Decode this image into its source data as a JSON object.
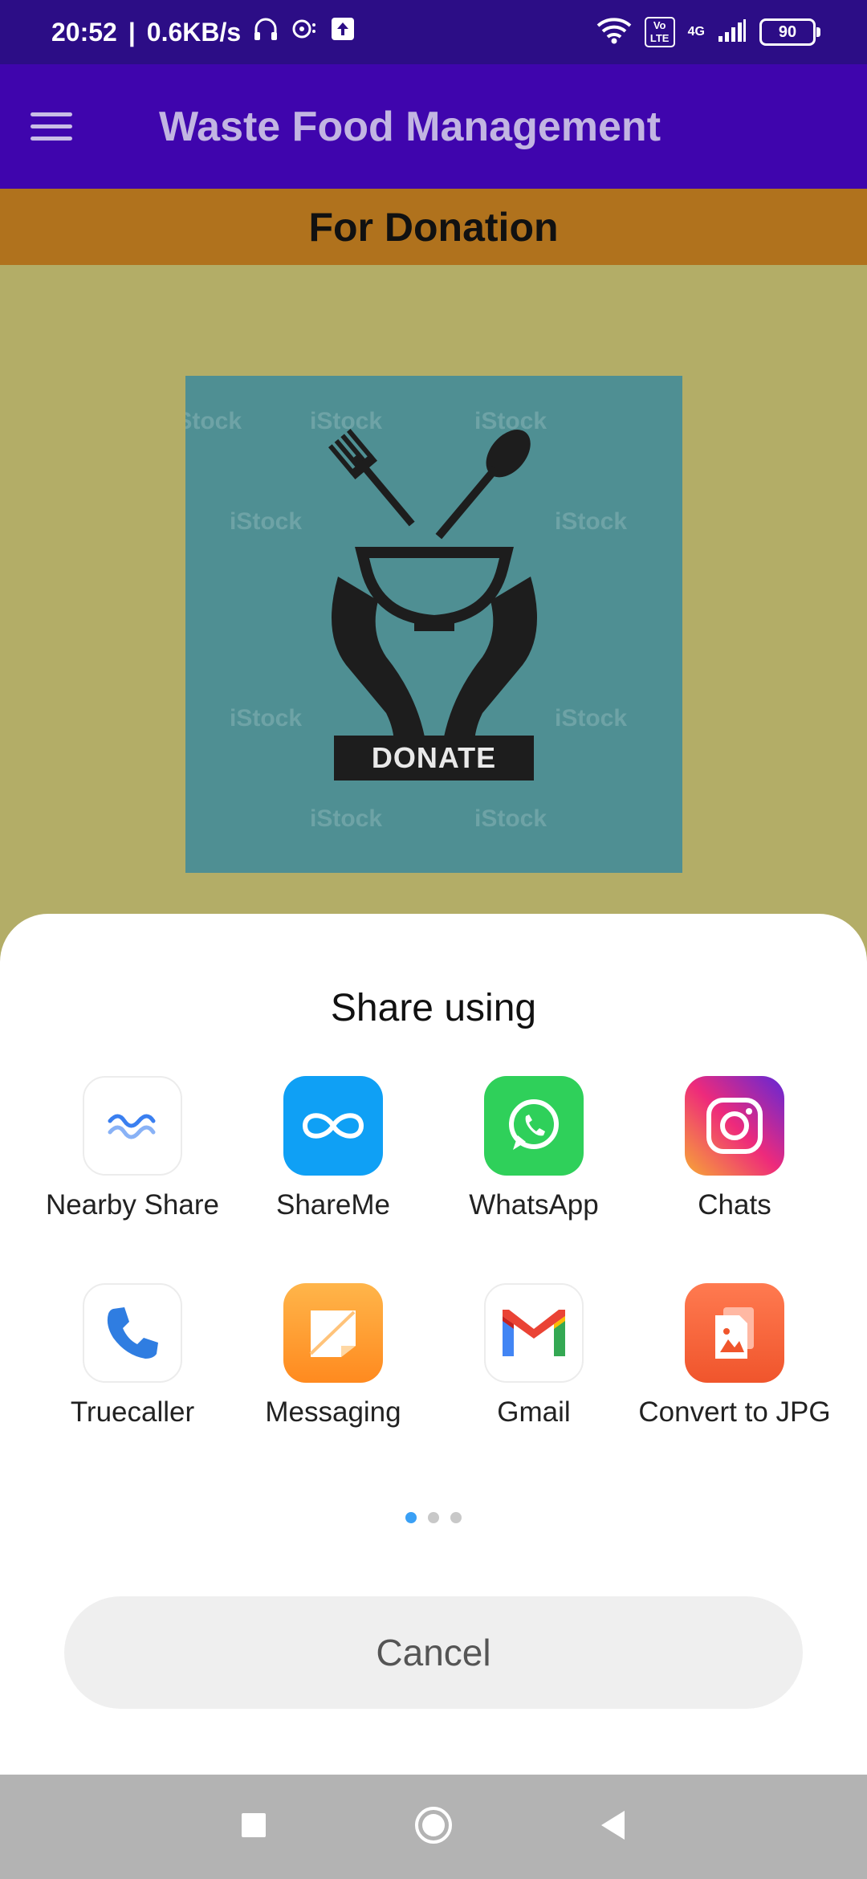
{
  "status_bar": {
    "time": "20:52",
    "speed": "0.6KB/s",
    "volte": "Vo LTE",
    "network": "4G",
    "battery": "90"
  },
  "app_bar": {
    "title": "Waste Food Management"
  },
  "banner": {
    "text": "For Donation"
  },
  "image": {
    "badge_text": "DONATE",
    "watermark": "iStock"
  },
  "share_sheet": {
    "title": "Share using",
    "apps": [
      {
        "label": "Nearby Share",
        "icon": "nearby-share-icon"
      },
      {
        "label": "ShareMe",
        "icon": "shareme-icon"
      },
      {
        "label": "WhatsApp",
        "icon": "whatsapp-icon"
      },
      {
        "label": "Chats",
        "icon": "instagram-icon"
      },
      {
        "label": "Truecaller",
        "icon": "truecaller-icon"
      },
      {
        "label": "Messaging",
        "icon": "messaging-icon"
      },
      {
        "label": "Gmail",
        "icon": "gmail-icon"
      },
      {
        "label": "Convert to JPG",
        "icon": "convert-to-jpg-icon"
      }
    ],
    "pages": 3,
    "current_page": 1,
    "cancel_label": "Cancel"
  },
  "colors": {
    "status_bar": "#2c0d86",
    "app_bar": "#3f05ad",
    "banner": "#b0721d",
    "page_background": "#b3ad67",
    "image_background": "#4f8f93",
    "active_dot": "#3aa0f5"
  }
}
